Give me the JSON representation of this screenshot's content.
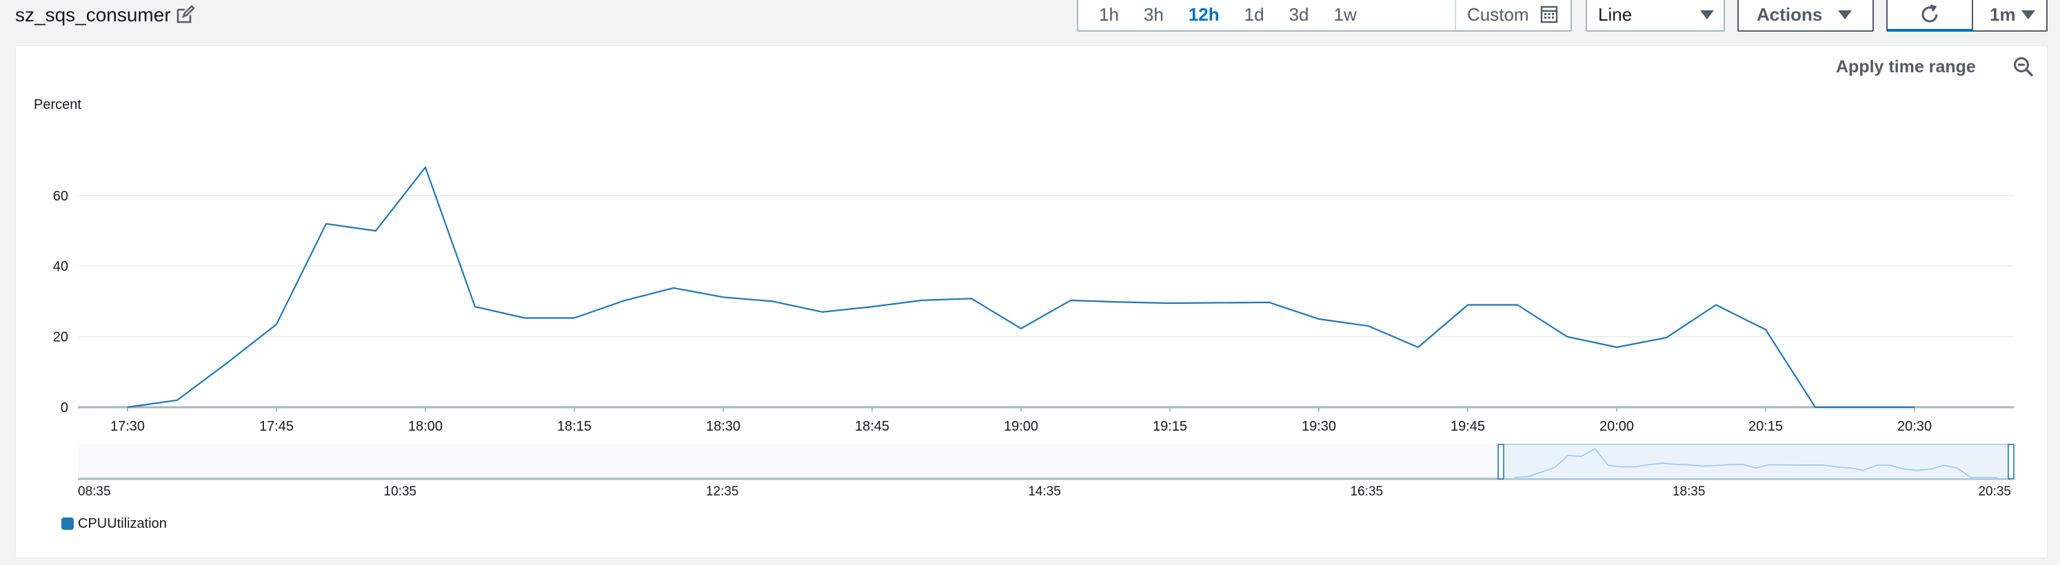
{
  "widget": {
    "title": "sz_sqs_consumer"
  },
  "time_range": {
    "options": [
      "1h",
      "3h",
      "12h",
      "1d",
      "3d",
      "1w"
    ],
    "active": "12h",
    "custom_label": "Custom"
  },
  "view_select": {
    "value": "Line"
  },
  "actions": {
    "label": "Actions"
  },
  "refresh": {
    "interval": "1m"
  },
  "panel": {
    "apply_time_range": "Apply time range"
  },
  "chart_data": {
    "type": "line",
    "ylabel": "Percent",
    "ylim": [
      0,
      75
    ],
    "yticks": [
      0,
      20,
      40,
      60
    ],
    "xlim": [
      "17:25",
      "20:40"
    ],
    "xticks": [
      "17:30",
      "17:45",
      "18:00",
      "18:15",
      "18:30",
      "18:45",
      "19:00",
      "19:15",
      "19:30",
      "19:45",
      "20:00",
      "20:15",
      "20:30"
    ],
    "grid": "horizontal",
    "series": [
      {
        "name": "CPUUtilization",
        "color": "#1f77b4",
        "x": [
          "17:30",
          "17:35",
          "17:40",
          "17:45",
          "17:50",
          "17:55",
          "18:00",
          "18:05",
          "18:10",
          "18:15",
          "18:20",
          "18:25",
          "18:30",
          "18:35",
          "18:40",
          "18:45",
          "18:50",
          "18:55",
          "19:00",
          "19:05",
          "19:10",
          "19:15",
          "19:20",
          "19:25",
          "19:30",
          "19:35",
          "19:40",
          "19:45",
          "19:50",
          "19:55",
          "20:00",
          "20:05",
          "20:10",
          "20:15",
          "20:20",
          "20:25",
          "20:30"
        ],
        "values": [
          0,
          2,
          12.5,
          23.5,
          52,
          50,
          68,
          28.5,
          25.3,
          25.3,
          30.2,
          33.8,
          31.2,
          30,
          27,
          28.5,
          30.3,
          30.8,
          22.3,
          30.3,
          29.8,
          29.5,
          29.6,
          29.7,
          25,
          23,
          17,
          29,
          29,
          20,
          17,
          19.7,
          29,
          22,
          0,
          0,
          0
        ]
      }
    ],
    "overview": {
      "xticks": [
        "08:35",
        "10:35",
        "12:35",
        "14:35",
        "16:35",
        "18:35",
        "20:35"
      ],
      "selected_range": [
        "17:25",
        "20:35"
      ]
    },
    "legend_position": "bottom-left"
  }
}
